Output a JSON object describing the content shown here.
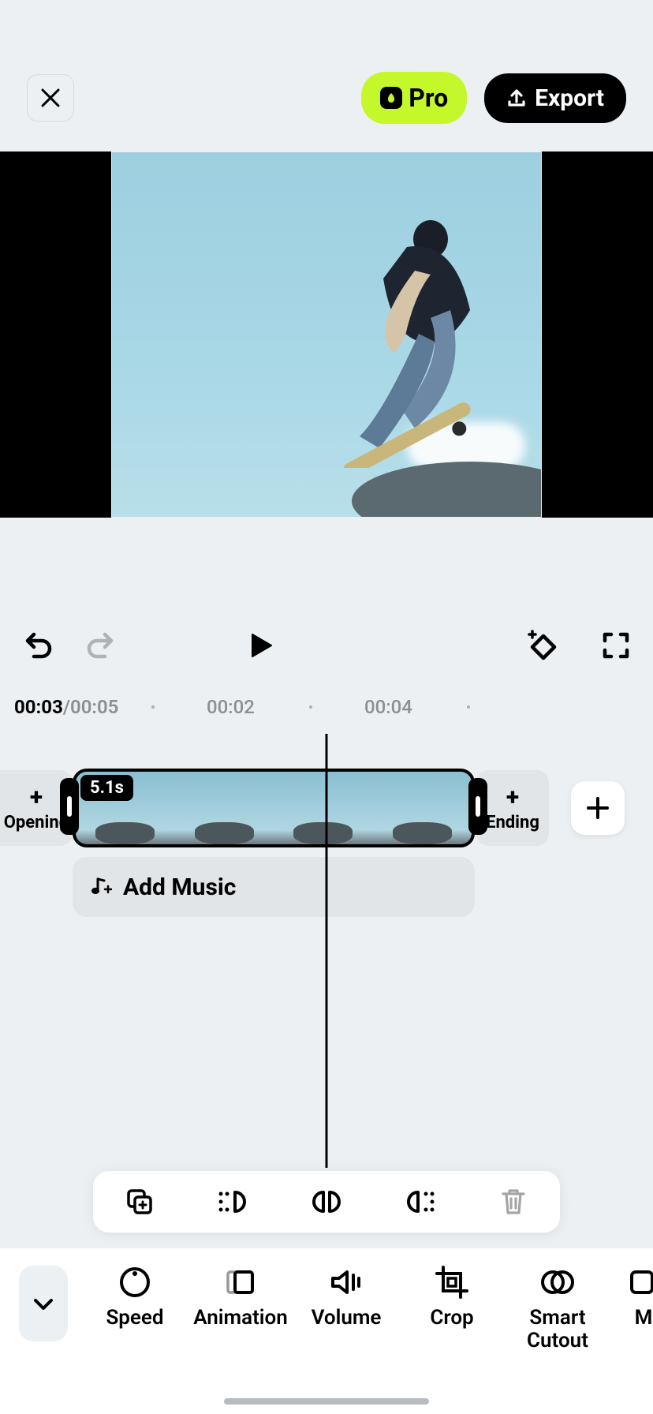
{
  "header": {
    "pro_label": "Pro",
    "export_label": "Export"
  },
  "preview": {
    "alt": "Skateboarder mid-air against blue sky"
  },
  "controls": {},
  "time": {
    "current": "00:03",
    "total": "00:05",
    "mark_1": "00:02",
    "mark_2": "00:04"
  },
  "timeline": {
    "opening_label": "Opening",
    "ending_label": "Ending",
    "clip_duration": "5.1s",
    "add_music_label": "Add Music"
  },
  "clip_actions": [
    "duplicate",
    "trim-left",
    "split",
    "trim-right",
    "delete"
  ],
  "tools": [
    {
      "name": "speed",
      "label": "Speed"
    },
    {
      "name": "animation",
      "label": "Animation"
    },
    {
      "name": "volume",
      "label": "Volume"
    },
    {
      "name": "crop",
      "label": "Crop"
    },
    {
      "name": "smart-cutout",
      "label": "Smart\nCutout"
    },
    {
      "name": "more",
      "label": "M"
    }
  ]
}
